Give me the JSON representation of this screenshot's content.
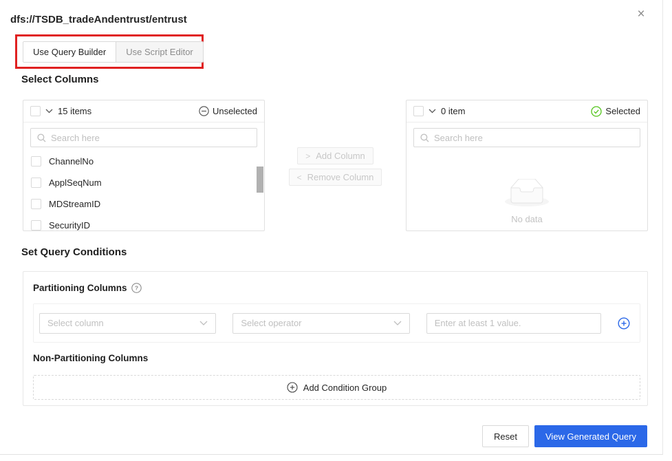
{
  "modal": {
    "title": "dfs://TSDB_tradeAndentrust/entrust",
    "close_glyph": "×"
  },
  "tabs": {
    "query_builder": "Use Query Builder",
    "script_editor": "Use Script Editor"
  },
  "select_columns": {
    "heading": "Select Columns",
    "source": {
      "count_label": "15 items",
      "status_label": "Unselected",
      "search_placeholder": "Search here",
      "items": [
        "ChannelNo",
        "ApplSeqNum",
        "MDStreamID",
        "SecurityID"
      ]
    },
    "transfer": {
      "add_label": "Add Column",
      "add_arrow": ">",
      "remove_label": "Remove Column",
      "remove_arrow": "<"
    },
    "target": {
      "count_label": "0 item",
      "status_label": "Selected",
      "search_placeholder": "Search here",
      "empty_text": "No data"
    }
  },
  "query_conditions": {
    "heading": "Set Query Conditions",
    "partitioning_label": "Partitioning Columns",
    "column_placeholder": "Select column",
    "operator_placeholder": "Select operator",
    "value_placeholder": "Enter at least 1 value.",
    "non_partitioning_label": "Non-Partitioning Columns",
    "add_condition_group_label": "Add Condition Group"
  },
  "footer": {
    "reset_label": "Reset",
    "primary_label": "View Generated Query"
  },
  "colors": {
    "primary_blue": "#2b68e8",
    "annotation_red": "#e02020",
    "success_green": "#52c41a",
    "icon_gray": "#595959"
  }
}
